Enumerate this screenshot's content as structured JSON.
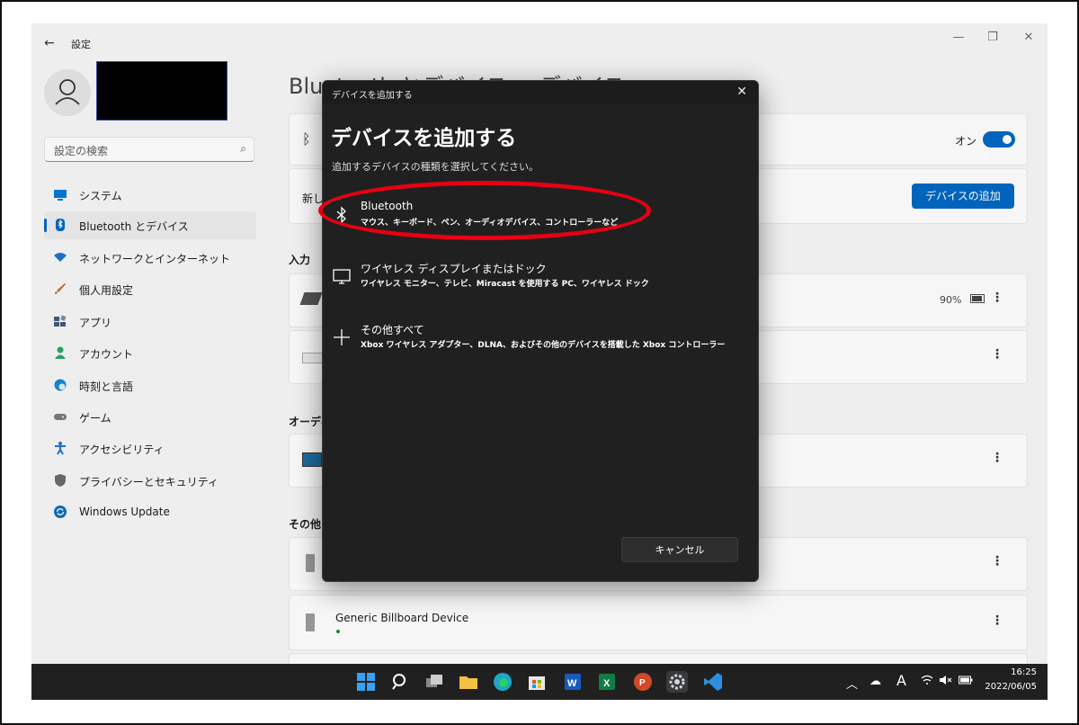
{
  "window": {
    "app_title": "設定",
    "controls": [
      "—",
      "❐",
      "✕"
    ],
    "page_title": "Bluetooth とデバイス > デバイス"
  },
  "search": {
    "placeholder": "設定の検索"
  },
  "sidebar": {
    "items": [
      {
        "label": "システム",
        "icon": "monitor-icon",
        "color": "#0078d4"
      },
      {
        "label": "Bluetooth とデバイス",
        "icon": "bluetooth-icon",
        "color": "#0067c0",
        "active": true
      },
      {
        "label": "ネットワークとインターネット",
        "icon": "wifi-icon",
        "color": "#1a73c7"
      },
      {
        "label": "個人用設定",
        "icon": "brush-icon",
        "color": "#c36b2a"
      },
      {
        "label": "アプリ",
        "icon": "apps-icon",
        "color": "#445a7a"
      },
      {
        "label": "アカウント",
        "icon": "account-icon",
        "color": "#2aa36b"
      },
      {
        "label": "時刻と言語",
        "icon": "globe-clock-icon",
        "color": "#1b87c9"
      },
      {
        "label": "ゲーム",
        "icon": "gamepad-icon",
        "color": "#7a7a7a"
      },
      {
        "label": "アクセシビリティ",
        "icon": "accessibility-icon",
        "color": "#1d6fd8"
      },
      {
        "label": "プライバシーとセキュリティ",
        "icon": "shield-icon",
        "color": "#6b6b6b"
      },
      {
        "label": "Windows Update",
        "icon": "update-icon",
        "color": "#0f6cbd"
      }
    ]
  },
  "main": {
    "bt_toggle_label": "オン",
    "new_device_prefix": "新し",
    "add_device_button": "デバイスの追加",
    "section_input": "入力",
    "battery_text": "90%",
    "section_audio": "オーディ",
    "section_other": "その他の",
    "generic_device_name": "Generic Billboard Device",
    "more_glyph": "⋮"
  },
  "dialog": {
    "window_title": "デバイスを追加する",
    "heading": "デバイスを追加する",
    "subtitle": "追加するデバイスの種類を選択してください。",
    "options": [
      {
        "title": "Bluetooth",
        "desc": "マウス、キーボード、ペン、オーディオデバイス、コントローラーなど",
        "icon": "bluetooth-icon"
      },
      {
        "title": "ワイヤレス ディスプレイまたはドック",
        "desc": "ワイヤレス モニター、テレビ、Miracast を使用する PC、ワイヤレス ドック",
        "icon": "display-icon"
      },
      {
        "title": "その他すべて",
        "desc": "Xbox ワイヤレス アダプター、DLNA、およびその他のデバイスを搭載した Xbox コントローラー",
        "icon": "plus-icon"
      }
    ],
    "cancel_button": "キャンセル",
    "highlight_color": "#e60012"
  },
  "taskbar": {
    "icons": [
      "start-icon",
      "search-icon",
      "task-view-icon",
      "file-explorer-icon",
      "edge-icon",
      "store-icon",
      "word-icon",
      "excel-icon",
      "powerpoint-icon",
      "settings-icon",
      "vscode-icon"
    ],
    "tray_ime": "A",
    "time": "16:25",
    "date": "2022/06/05"
  }
}
